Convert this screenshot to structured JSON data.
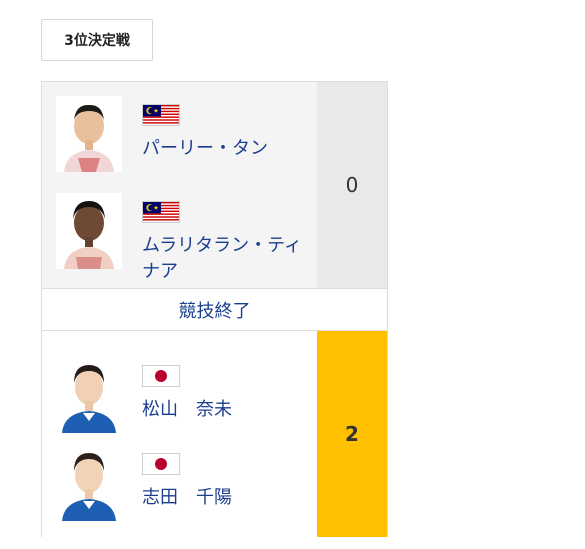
{
  "stage": {
    "label": "3位決定戦"
  },
  "match": {
    "status": "競技終了",
    "team_top": {
      "score": "0",
      "players": [
        {
          "name": "パーリー・タン",
          "country_flag": "malaysia-flag"
        },
        {
          "name": "ムラリタラン・ティナア",
          "country_flag": "malaysia-flag"
        }
      ]
    },
    "team_bottom": {
      "score": "2",
      "winner": true,
      "players": [
        {
          "name": "松山　奈未",
          "country_flag": "japan-flag"
        },
        {
          "name": "志田　千陽",
          "country_flag": "japan-flag"
        }
      ]
    }
  },
  "colors": {
    "winner_score_bg": "#ffc000",
    "loser_score_bg": "#e9e9e9",
    "name_text": "#1b3f8f"
  }
}
